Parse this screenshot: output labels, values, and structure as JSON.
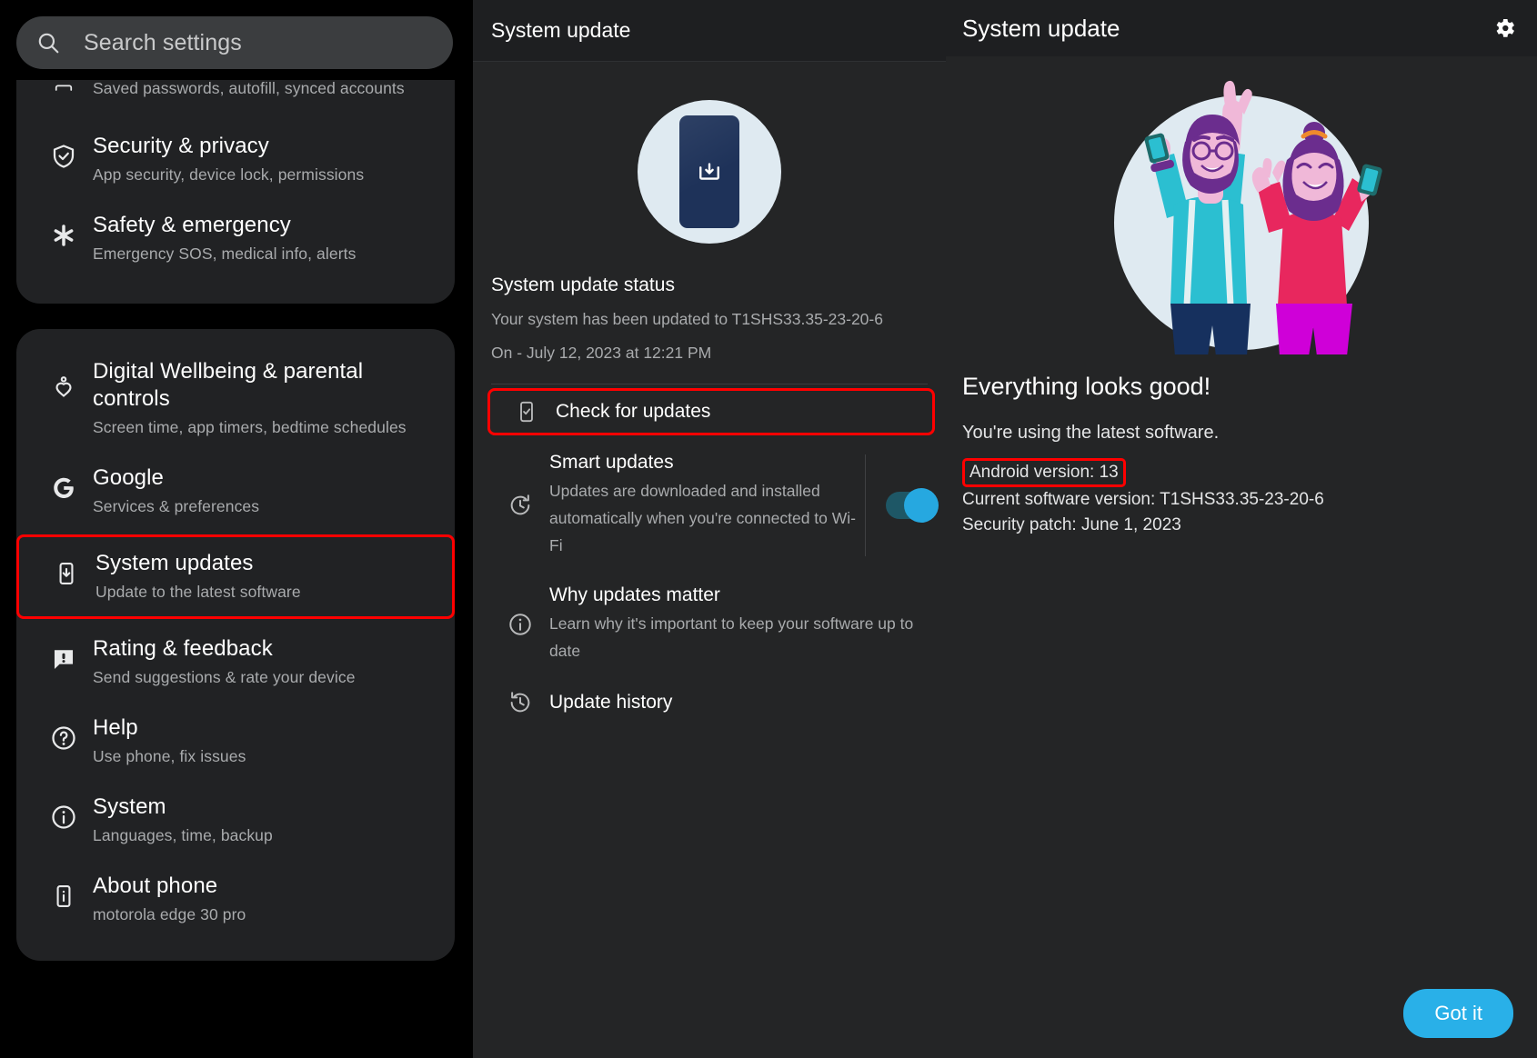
{
  "search": {
    "placeholder": "Search settings",
    "icon": "search-icon"
  },
  "sidebar": {
    "group_top": [
      {
        "icon": "wallet-icon",
        "title": "",
        "subtitle": "Saved passwords, autofill, synced accounts",
        "highlighted": false
      },
      {
        "icon": "shield-check-icon",
        "title": "Security & privacy",
        "subtitle": "App security, device lock, permissions",
        "highlighted": false
      },
      {
        "icon": "asterisk-icon",
        "title": "Safety & emergency",
        "subtitle": "Emergency SOS, medical info, alerts",
        "highlighted": false
      }
    ],
    "group_mid": [
      {
        "icon": "wellbeing-icon",
        "title": "Digital Wellbeing & parental controls",
        "subtitle": "Screen time, app timers, bedtime schedules",
        "highlighted": false
      },
      {
        "icon": "google-g-icon",
        "title": "Google",
        "subtitle": "Services & preferences",
        "highlighted": false
      },
      {
        "icon": "system-update-icon",
        "title": "System updates",
        "subtitle": "Update to the latest software",
        "highlighted": true
      },
      {
        "icon": "feedback-icon",
        "title": "Rating & feedback",
        "subtitle": "Send suggestions & rate your device",
        "highlighted": false
      },
      {
        "icon": "help-icon",
        "title": "Help",
        "subtitle": "Use phone, fix issues",
        "highlighted": false
      },
      {
        "icon": "info-icon",
        "title": "System",
        "subtitle": "Languages, time, backup",
        "highlighted": false
      },
      {
        "icon": "about-phone-icon",
        "title": "About phone",
        "subtitle": "motorola edge 30 pro",
        "highlighted": false
      }
    ]
  },
  "middle": {
    "header_title": "System update",
    "illustration": "phone-download-illustration",
    "status_title": "System update status",
    "status_line_1": "Your system has been updated to T1SHS33.35-23-20-6",
    "status_line_2": "On - July 12, 2023 at 12:21 PM",
    "rows": [
      {
        "icon": "check-phone-icon",
        "label": "Check for updates",
        "subtitle": "",
        "highlighted": true,
        "toggle": null
      },
      {
        "icon": "history-refresh-icon",
        "label": "Smart updates",
        "subtitle": "Updates are downloaded and installed automatically when you're connected to Wi-Fi",
        "highlighted": false,
        "toggle": "on"
      },
      {
        "icon": "info-icon",
        "label": "Why updates matter",
        "subtitle": "Learn why it's important to keep your software up to date",
        "highlighted": false,
        "toggle": null
      },
      {
        "icon": "history-icon",
        "label": "Update history",
        "subtitle": "",
        "highlighted": false,
        "toggle": null
      }
    ]
  },
  "right": {
    "header_title": "System update",
    "gear_icon": "gear-icon",
    "illustration": "celebrating-people-illustration",
    "headline": "Everything looks good!",
    "subline": "You're using the latest software.",
    "android_version": "Android version: 13",
    "current_software_version": "Current software version: T1SHS33.35-23-20-6",
    "security_patch": "Security patch: June 1, 2023",
    "got_it_label": "Got it"
  },
  "colors": {
    "accent": "#29b0e8",
    "highlight_box": "#ff0000",
    "panel_bg": "#242526",
    "sidebar_card": "#212224",
    "toggle_track": "#1e5766"
  }
}
